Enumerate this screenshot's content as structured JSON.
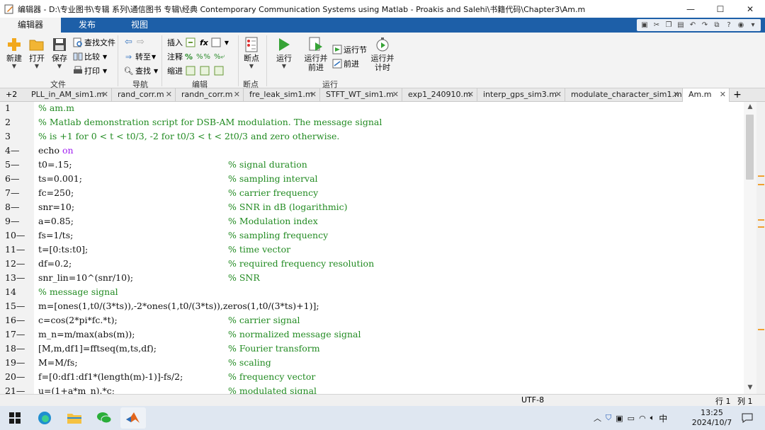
{
  "window": {
    "title": "编辑器 - D:\\专业图书\\专辑 系列\\通信图书  专辑\\经典 Contemporary Communication Systems using Matlab - Proakis and Salehi\\书籍代码\\Chapter3\\Am.m",
    "controls": [
      "minimize-icon",
      "maximize-icon",
      "close-icon"
    ]
  },
  "ribbon_tabs": [
    "编辑器",
    "发布",
    "视图"
  ],
  "ribbon": {
    "file": {
      "new": "新建",
      "open": "打开",
      "save": "保存",
      "find_files": "查找文件",
      "compare": "比较",
      "print": "打印",
      "group": "文件"
    },
    "navigate": {
      "goto": "转至",
      "find": "查找",
      "group": "导航"
    },
    "edit": {
      "insert": "插入",
      "comment": "注释",
      "indent": "缩进",
      "fx": "fx",
      "group": "编辑"
    },
    "breakpoints": {
      "label": "断点",
      "group": "断点"
    },
    "run": {
      "run": "运行",
      "run_advance": "运行并\n前进",
      "run_section": "运行节",
      "advance": "前进",
      "run_time": "运行并\n计时",
      "group": "运行"
    }
  },
  "file_tabs": {
    "overflow": "+2",
    "tabs": [
      "PLL_in_AM_sim1.m",
      "rand_corr.m",
      "randn_corr.m",
      "fre_leak_sim1.m",
      "STFT_WT_sim1.m",
      "exp1_240910.m",
      "interp_gps_sim3.m",
      "modulate_character_sim1.m",
      "Am.m"
    ],
    "active": "Am.m",
    "add": "+"
  },
  "code": {
    "lines": [
      {
        "n": "1",
        "code": "% am.m",
        "comment": "",
        "type": "comment"
      },
      {
        "n": "2",
        "code": "% Matlab demonstration script for DSB-AM modulation. The message signal",
        "comment": "",
        "type": "comment"
      },
      {
        "n": "3",
        "code": "% is +1 for 0 < t < t0/3, -2 for t0/3 < t < 2t0/3 and zero otherwise.",
        "comment": "",
        "type": "comment"
      },
      {
        "n": "4—",
        "code": "echo ",
        "kw": "on",
        "comment": "",
        "type": "code"
      },
      {
        "n": "5—",
        "code": "t0=.15;",
        "comment": "% signal duration",
        "type": "code"
      },
      {
        "n": "6—",
        "code": "ts=0.001;",
        "comment": "% sampling interval",
        "type": "code"
      },
      {
        "n": "7—",
        "code": "fc=250;",
        "comment": "% carrier frequency",
        "type": "code"
      },
      {
        "n": "8—",
        "code": "snr=10;",
        "comment": "% SNR in dB (logarithmic)",
        "type": "code"
      },
      {
        "n": "9—",
        "code": "a=0.85;",
        "comment": "% Modulation index",
        "type": "code"
      },
      {
        "n": "10—",
        "code": "fs=1/ts;",
        "comment": "% sampling frequency",
        "type": "code"
      },
      {
        "n": "11—",
        "code": "t=[0:ts:t0];",
        "comment": "% time vector",
        "type": "code"
      },
      {
        "n": "12—",
        "code": "df=0.2;",
        "comment": "% required frequency resolution",
        "type": "code"
      },
      {
        "n": "13—",
        "code": "snr_lin=10^(snr/10);",
        "comment": "% SNR",
        "type": "code"
      },
      {
        "n": "14",
        "code": "% message signal",
        "comment": "",
        "type": "comment"
      },
      {
        "n": "15—",
        "code": "m=[ones(1,t0/(3*ts)),-2*ones(1,t0/(3*ts)),zeros(1,t0/(3*ts)+1)];",
        "comment": "",
        "type": "code"
      },
      {
        "n": "16—",
        "code": "c=cos(2*pi*fc.*t);",
        "comment": "% carrier signal",
        "type": "code"
      },
      {
        "n": "17—",
        "code": "m_n=m/max(abs(m));",
        "comment": "% normalized message signal",
        "type": "code"
      },
      {
        "n": "18—",
        "code": "[M,m,df1]=fftseq(m,ts,df);",
        "comment": "% Fourier transform",
        "type": "code"
      },
      {
        "n": "19—",
        "code": "M=M/fs;",
        "comment": "% scaling",
        "type": "code"
      },
      {
        "n": "20—",
        "code": "f=[0:df1:df1*(length(m)-1)]-fs/2;",
        "comment": "% frequency vector",
        "type": "code"
      },
      {
        "n": "21—",
        "code": "u=(1+a*m_n).*c;",
        "comment": "% modulated signal",
        "type": "code"
      }
    ]
  },
  "status": {
    "encoding": "UTF-8",
    "row": "行 1",
    "col": "列 1"
  },
  "taskbar": {
    "ime": "中",
    "time": "13:25",
    "date": "2024/10/7"
  },
  "colors": {
    "ribbon_blue": "#1d5fa8",
    "comment_green": "#228b22",
    "keyword_purple": "#a020f0"
  }
}
